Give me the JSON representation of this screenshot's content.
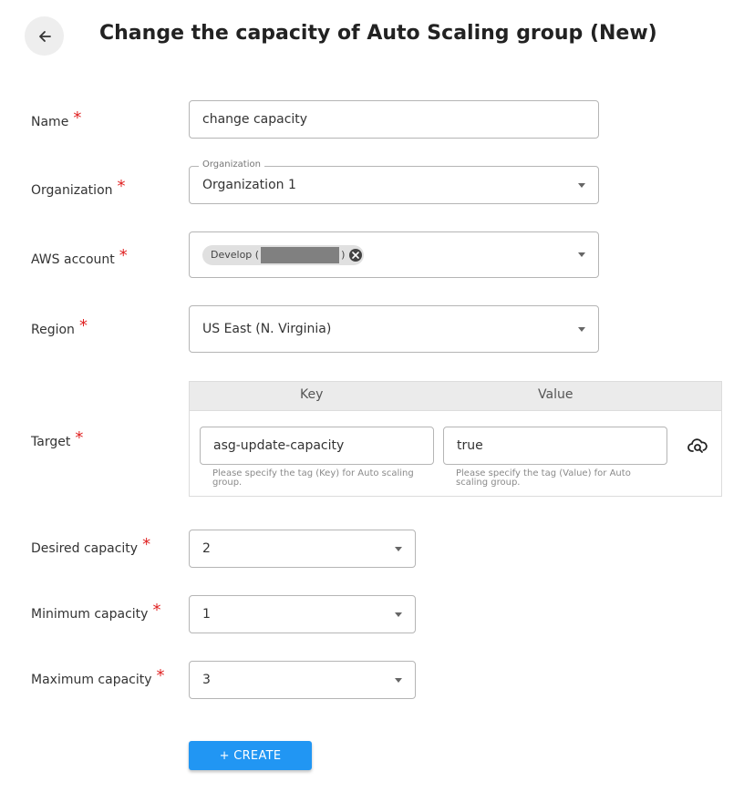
{
  "header": {
    "title": "Change the capacity of Auto Scaling group (New)"
  },
  "form": {
    "name": {
      "label": "Name",
      "value": "change capacity"
    },
    "organization": {
      "label": "Organization",
      "float_label": "Organization",
      "value": "Organization 1"
    },
    "aws_account": {
      "label": "AWS account",
      "chip_label": "Develop (",
      "chip_suffix": ")"
    },
    "region": {
      "label": "Region",
      "value": "US East (N. Virginia)"
    },
    "target": {
      "label": "Target",
      "key_header": "Key",
      "value_header": "Value",
      "key_value": "asg-update-capacity",
      "value_value": "true",
      "key_helper": "Please specify the tag (Key) for Auto scaling group.",
      "value_helper": "Please specify the tag (Value) for Auto scaling group."
    },
    "desired": {
      "label": "Desired capacity",
      "value": "2"
    },
    "minimum": {
      "label": "Minimum capacity",
      "value": "1"
    },
    "maximum": {
      "label": "Maximum capacity",
      "value": "3"
    },
    "required_mark": "*",
    "create_label": "+ CREATE"
  },
  "icons": {
    "back": "arrow-left-icon",
    "cloud_search": "cloud-search-icon",
    "chip_close": "close-circle-icon",
    "caret": "caret-down-icon"
  },
  "colors": {
    "accent": "#2196f3",
    "required": "#e02424"
  }
}
